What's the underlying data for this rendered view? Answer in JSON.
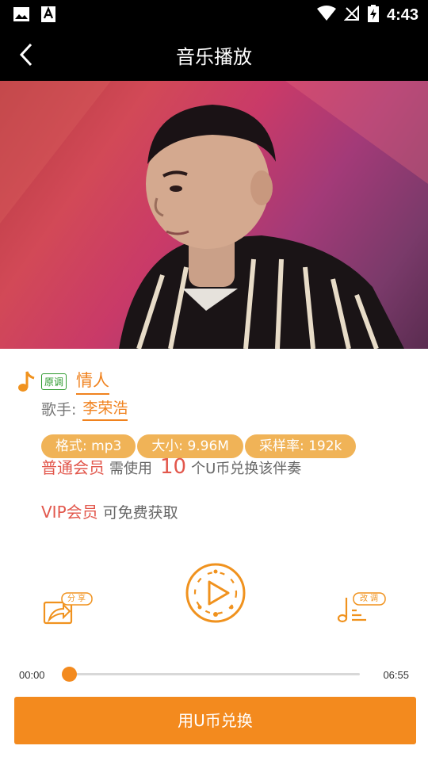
{
  "status_bar": {
    "time": "4:43"
  },
  "header": {
    "title": "音乐播放"
  },
  "song": {
    "tag": "原调",
    "name": "情人",
    "singer_label": "歌手:",
    "singer": "李荣浩"
  },
  "info": {
    "format": "格式: mp3",
    "size": "大小: 9.96M",
    "sample_rate": "采样率: 192k"
  },
  "membership": {
    "normal_label": "普通会员",
    "normal_prefix": "需使用",
    "coins": "10",
    "normal_suffix": "个U币兑换该伴奏",
    "vip_label": "VIP会员",
    "vip_text": "可免费获取"
  },
  "actions": {
    "share_label": "分享",
    "tune_label": "改调"
  },
  "player": {
    "current_time": "00:00",
    "total_time": "06:55",
    "progress": 0
  },
  "exchange_button": "用U币兑换",
  "colors": {
    "accent": "#f38a1e",
    "badge": "#f0b357",
    "red": "#e2574c",
    "green": "#2e9a2e"
  }
}
